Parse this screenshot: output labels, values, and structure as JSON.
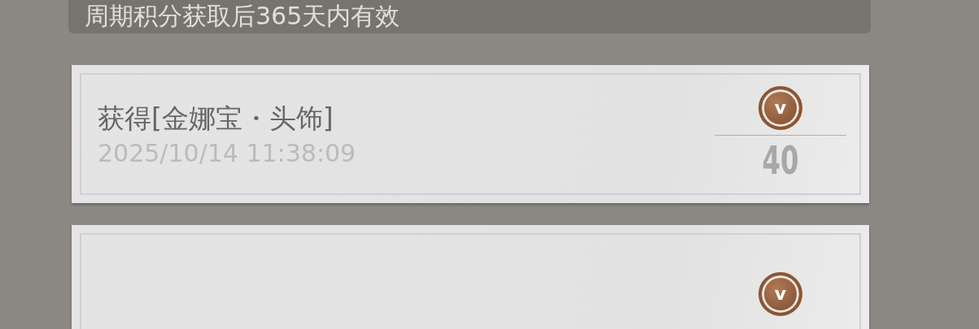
{
  "notice": {
    "text": "周期积分获取后365天内有效"
  },
  "records": [
    {
      "title": "获得[金娜宝・头饰]",
      "time": "2025/10/14 11:38:09",
      "coin": "v",
      "amount": "40"
    },
    {
      "coin": "v"
    }
  ]
}
